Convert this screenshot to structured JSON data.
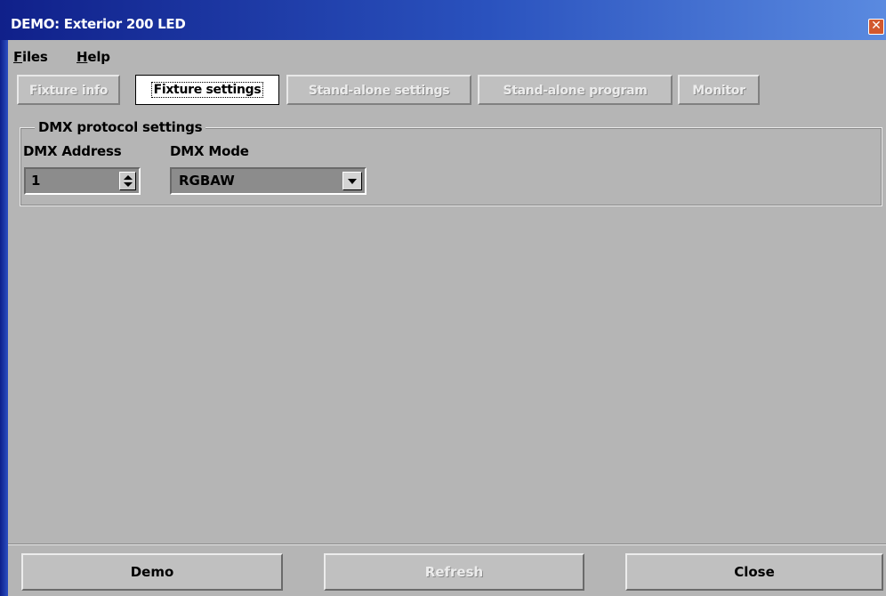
{
  "window": {
    "title": "DEMO: Exterior 200 LED",
    "close_glyph": "✕"
  },
  "menu": {
    "files": {
      "mnemonic": "F",
      "rest": "iles"
    },
    "help": {
      "mnemonic": "H",
      "rest": "elp"
    }
  },
  "tabs": [
    {
      "label": "Fixture info",
      "active": false,
      "enabled": false
    },
    {
      "label": "Fixture settings",
      "active": true,
      "enabled": true
    },
    {
      "label": "Stand-alone settings",
      "active": false,
      "enabled": false
    },
    {
      "label": "Stand-alone program",
      "active": false,
      "enabled": false
    },
    {
      "label": "Monitor",
      "active": false,
      "enabled": false
    }
  ],
  "dmx": {
    "group_title": "DMX protocol settings",
    "address_label": "DMX Address",
    "address_value": "1",
    "mode_label": "DMX Mode",
    "mode_value": "RGBAW"
  },
  "buttons": {
    "demo": "Demo",
    "refresh": "Refresh",
    "close": "Close"
  },
  "colors": {
    "titlebar_start": "#10208a",
    "titlebar_end": "#5a8ae0",
    "face": "#b5b5b5",
    "close_button": "#d2582e"
  }
}
